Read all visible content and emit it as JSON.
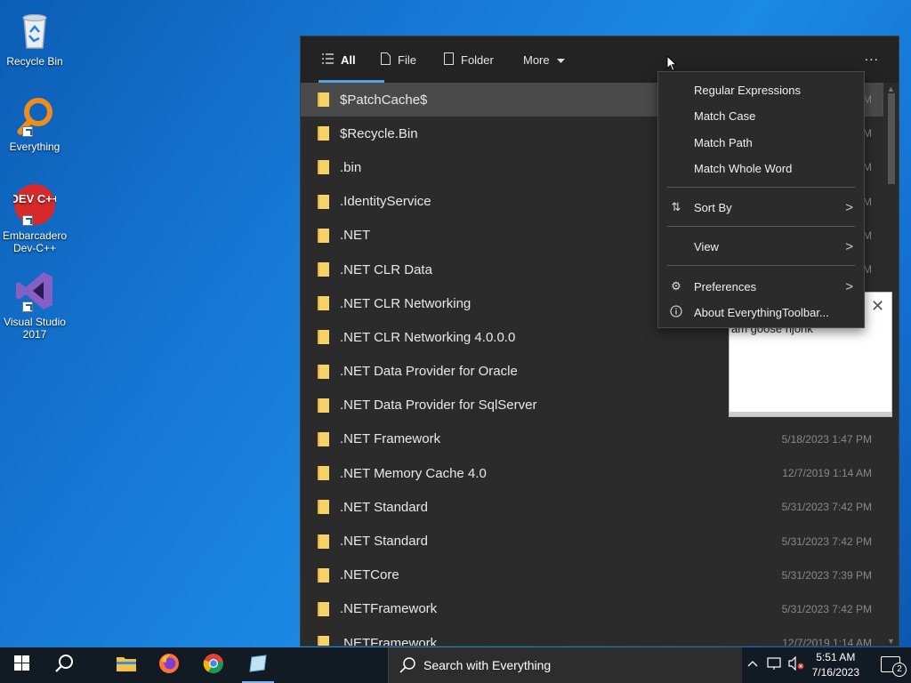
{
  "desktop": {
    "icons": [
      {
        "label": "Recycle Bin",
        "icon": "recycle-bin-icon"
      },
      {
        "label": "Everything",
        "icon": "magnifier-icon"
      },
      {
        "label": "Embarcadero Dev-C++",
        "icon": "devcpp-icon",
        "art_text": "DEV C++"
      },
      {
        "label": "Visual Studio 2017",
        "icon": "visual-studio-icon"
      }
    ]
  },
  "popup": {
    "tabs": [
      {
        "label": "All",
        "icon": "list-icon",
        "active": true
      },
      {
        "label": "File",
        "icon": "file-icon"
      },
      {
        "label": "Folder",
        "icon": "folder-icon"
      },
      {
        "label": "More",
        "icon": "caret-down-icon"
      }
    ],
    "more_button": "...",
    "rows": [
      {
        "name": "$PatchCache$",
        "date": "M"
      },
      {
        "name": "$Recycle.Bin",
        "date": "M"
      },
      {
        "name": ".bin",
        "date": "M"
      },
      {
        "name": ".IdentityService",
        "date": "M"
      },
      {
        "name": ".NET",
        "date": "M"
      },
      {
        "name": ".NET CLR Data",
        "date": "M"
      },
      {
        "name": ".NET CLR Networking",
        "date": ""
      },
      {
        "name": ".NET CLR Networking 4.0.0.0",
        "date": ""
      },
      {
        "name": ".NET Data Provider for Oracle",
        "date": ""
      },
      {
        "name": ".NET Data Provider for SqlServer",
        "date": ""
      },
      {
        "name": ".NET Framework",
        "date": "5/18/2023 1:47 PM"
      },
      {
        "name": ".NET Memory Cache 4.0",
        "date": "12/7/2019 1:14 AM"
      },
      {
        "name": ".NET Standard",
        "date": "5/31/2023 7:42 PM"
      },
      {
        "name": ".NET Standard",
        "date": "5/31/2023 7:42 PM"
      },
      {
        "name": ".NETCore",
        "date": "5/31/2023 7:39 PM"
      },
      {
        "name": ".NETFramework",
        "date": "5/31/2023 7:42 PM"
      },
      {
        "name": ".NETFramework",
        "date": "12/7/2019 1:14 AM"
      }
    ]
  },
  "menu": {
    "items": [
      {
        "label": "Regular Expressions"
      },
      {
        "label": "Match Case"
      },
      {
        "label": "Match Path"
      },
      {
        "label": "Match Whole Word"
      },
      {
        "label": "Sort By",
        "icon": "sort-icon",
        "submenu": true
      },
      {
        "label": "View",
        "submenu": true
      },
      {
        "label": "Preferences",
        "icon": "gear-icon",
        "submenu": true
      },
      {
        "label": "About EverythingToolbar...",
        "icon": "info-icon"
      }
    ]
  },
  "note_window": {
    "text": "am goose njohk",
    "close": "✕"
  },
  "taskbar": {
    "search_text": "Search with Everything",
    "time": "5:51 AM",
    "date": "7/16/2023",
    "notifications": "2"
  },
  "colors": {
    "accent": "#4fa2e6",
    "popup_bg": "#2b2b2b",
    "folder": "#f5d26a"
  }
}
